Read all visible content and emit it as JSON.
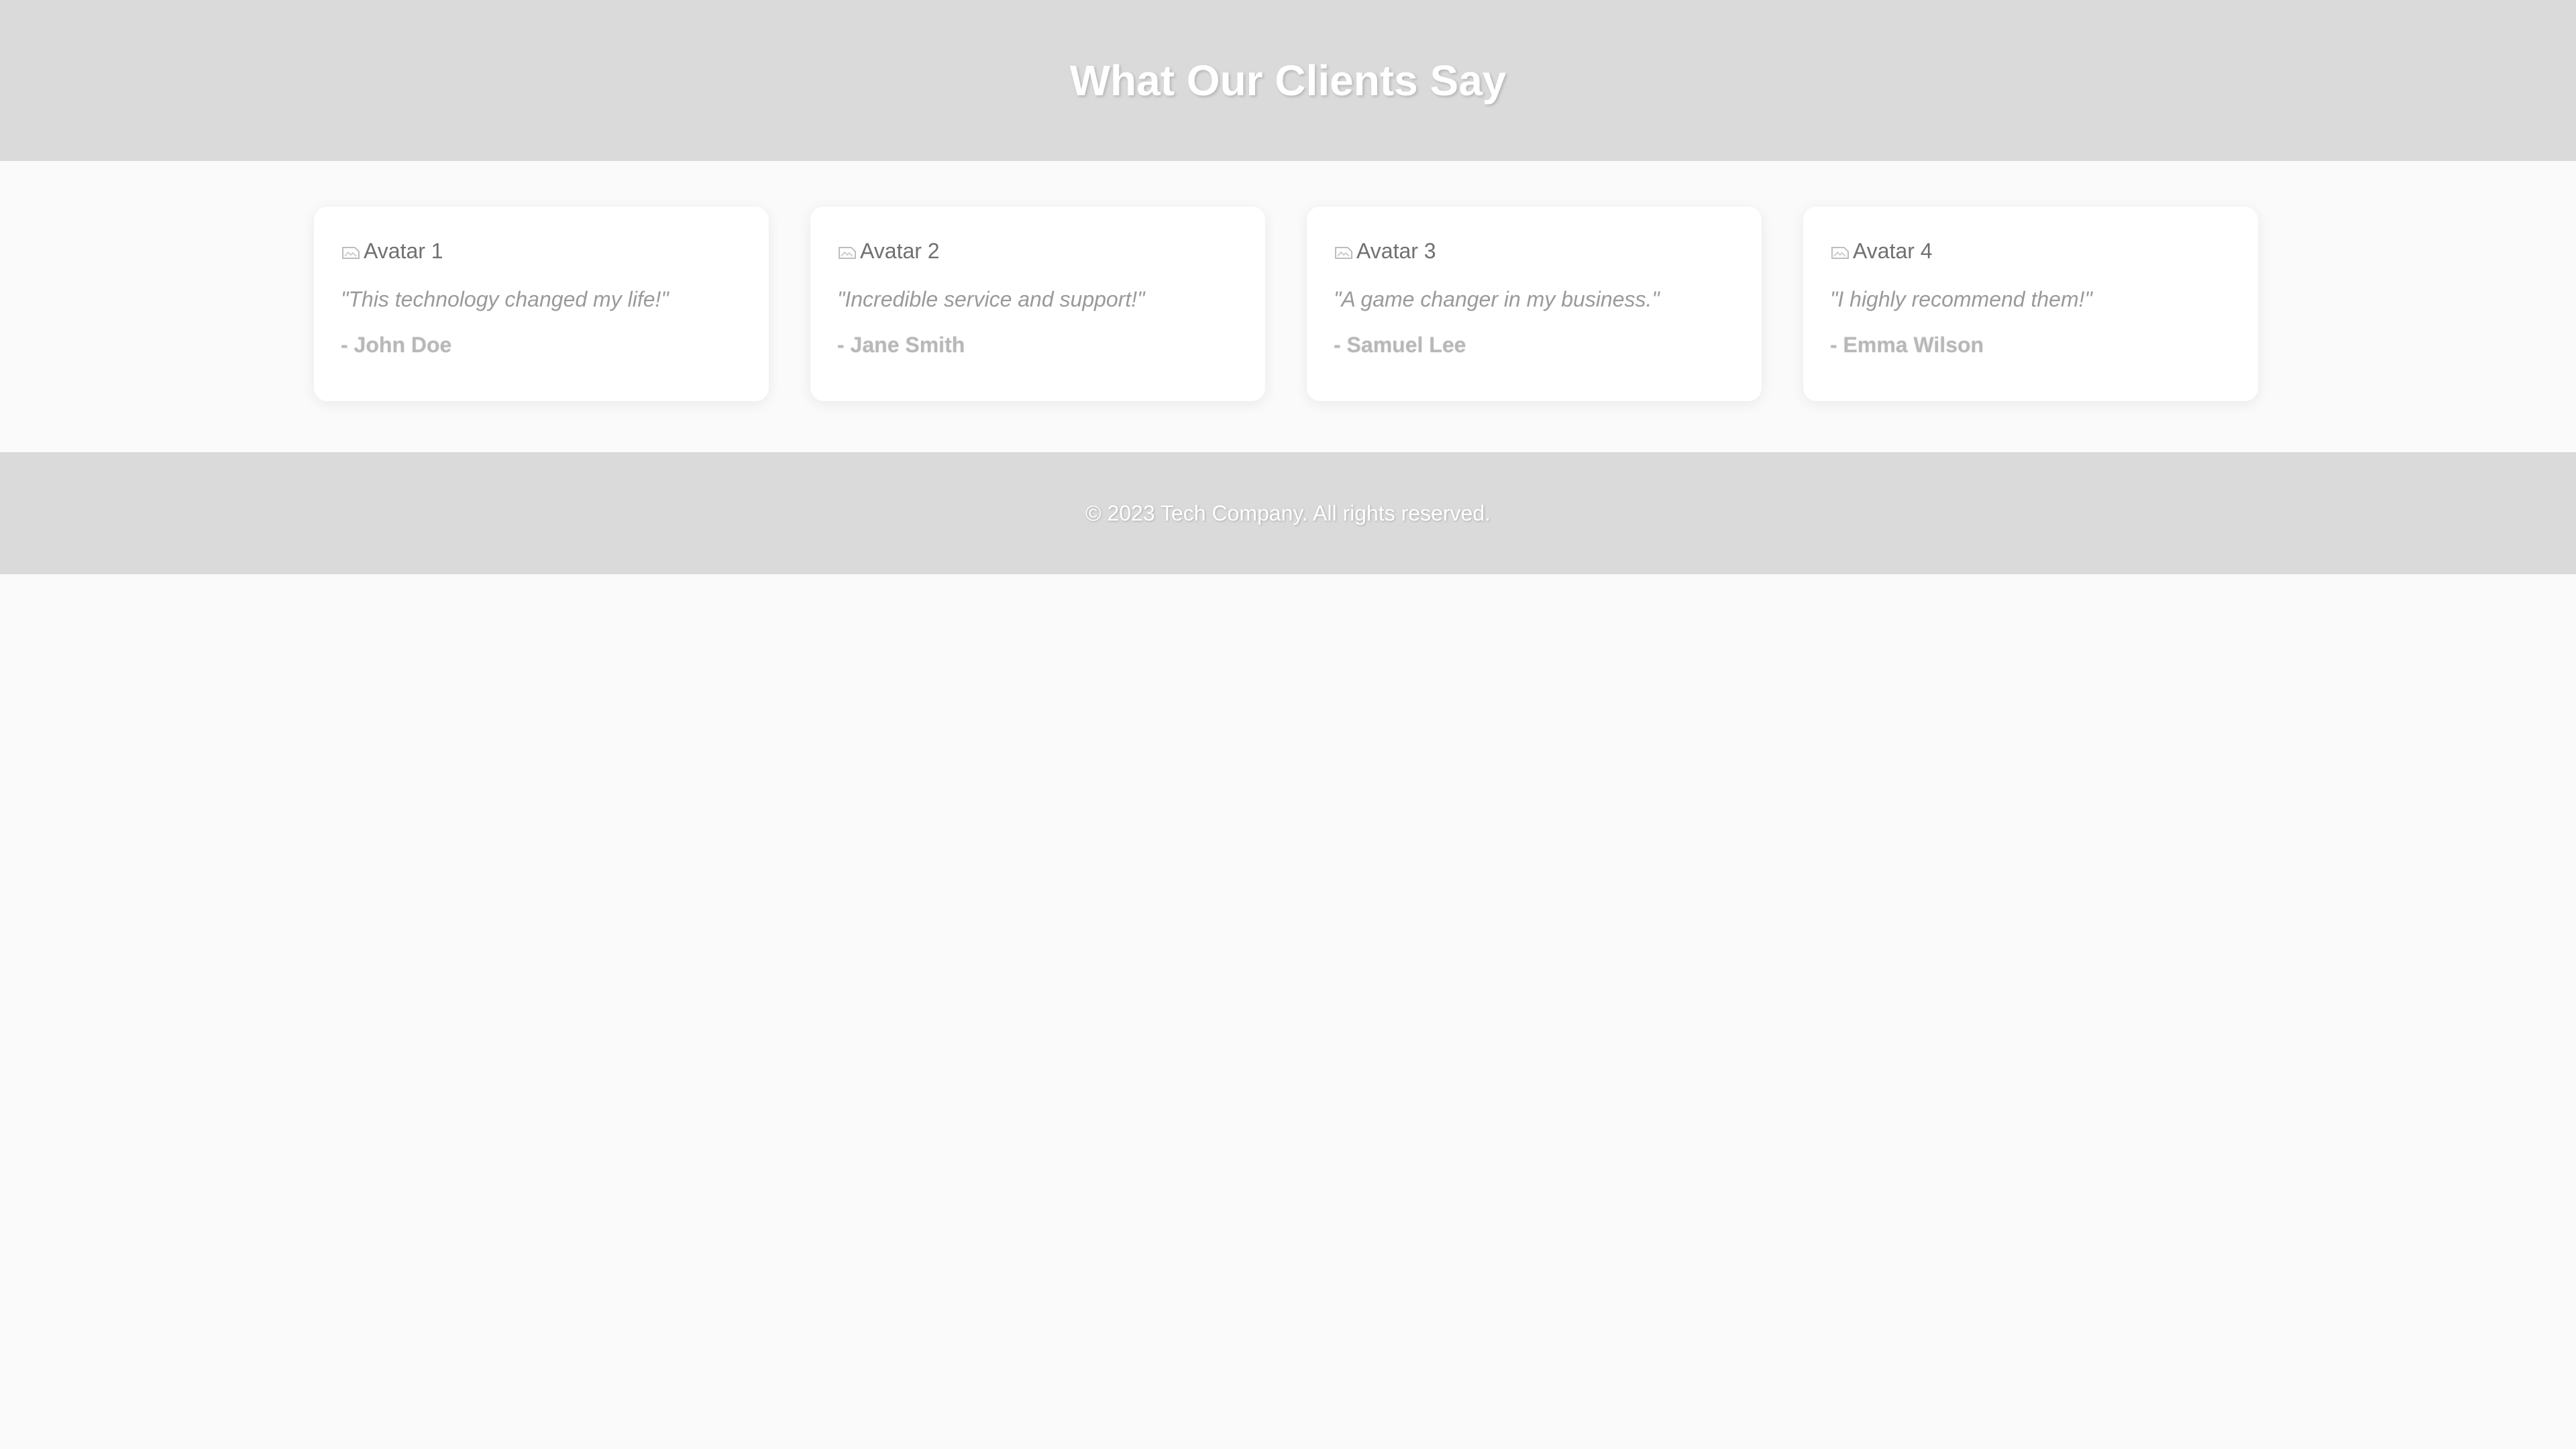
{
  "header": {
    "title": "What Our Clients Say"
  },
  "testimonials": [
    {
      "avatar_alt": "Avatar 1",
      "quote": "\"This technology changed my life!\"",
      "author": "- John Doe",
      "avatar_icon": "broken-image-icon"
    },
    {
      "avatar_alt": "Avatar 2",
      "quote": "\"Incredible service and support!\"",
      "author": "- Jane Smith",
      "avatar_icon": "broken-image-icon"
    },
    {
      "avatar_alt": "Avatar 3",
      "quote": "\"A game changer in my business.\"",
      "author": "- Samuel Lee",
      "avatar_icon": "broken-image-icon"
    },
    {
      "avatar_alt": "Avatar 4",
      "quote": "\"I highly recommend them!\"",
      "author": "- Emma Wilson",
      "avatar_icon": "broken-image-icon"
    }
  ],
  "footer": {
    "text": "© 2023 Tech Company. All rights reserved."
  },
  "colors": {
    "header_bg": "#dadada",
    "page_bg": "#fafafa",
    "card_bg": "#ffffff",
    "footer_bg": "#dadada"
  }
}
